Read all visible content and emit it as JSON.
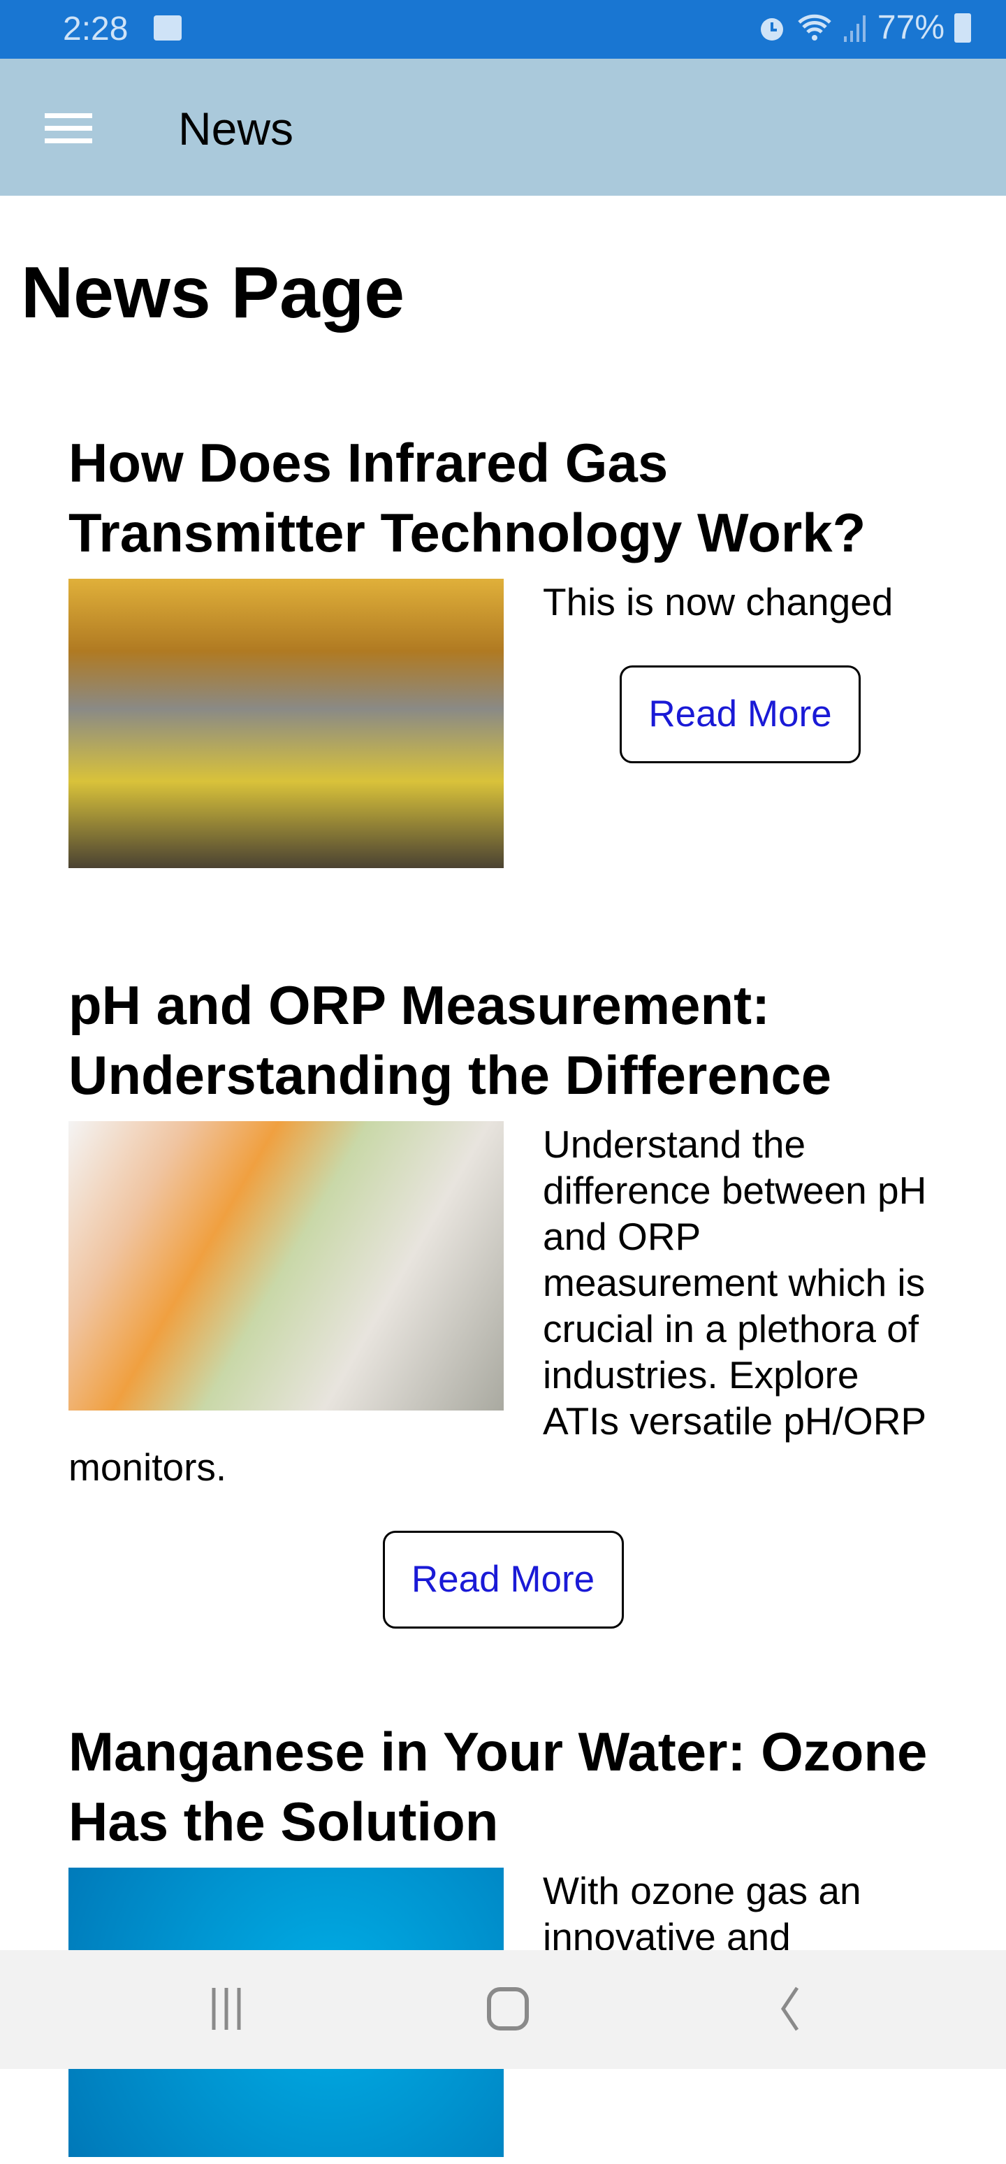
{
  "status_bar": {
    "time": "2:28",
    "battery": "77%",
    "icons": [
      "image-icon",
      "alarm-icon",
      "wifi-icon",
      "signal-icon",
      "battery-charging-icon"
    ]
  },
  "app_bar": {
    "title": "News",
    "menu_icon": "hamburger-icon"
  },
  "page_title": "News Page",
  "articles": [
    {
      "title": "How Does Infrared Gas Transmitter Technology Work?",
      "summary": "This is now changed",
      "button": "Read More"
    },
    {
      "title": "pH and ORP Measurement: Understanding the Difference",
      "summary": "Understand the difference between pH and ORP measurement which is crucial in a plethora of industries. Explore ATIs versatile pH/ORP monitors.",
      "button": "Read More"
    },
    {
      "title": "Manganese in Your Water: Ozone Has the Solution",
      "summary": "With ozone gas an innovative and"
    }
  ],
  "colors": {
    "status_bar": "#1976d2",
    "app_bar": "#aac9db",
    "link": "#1a1ad6",
    "nav_bar": "#f2f2f2"
  }
}
